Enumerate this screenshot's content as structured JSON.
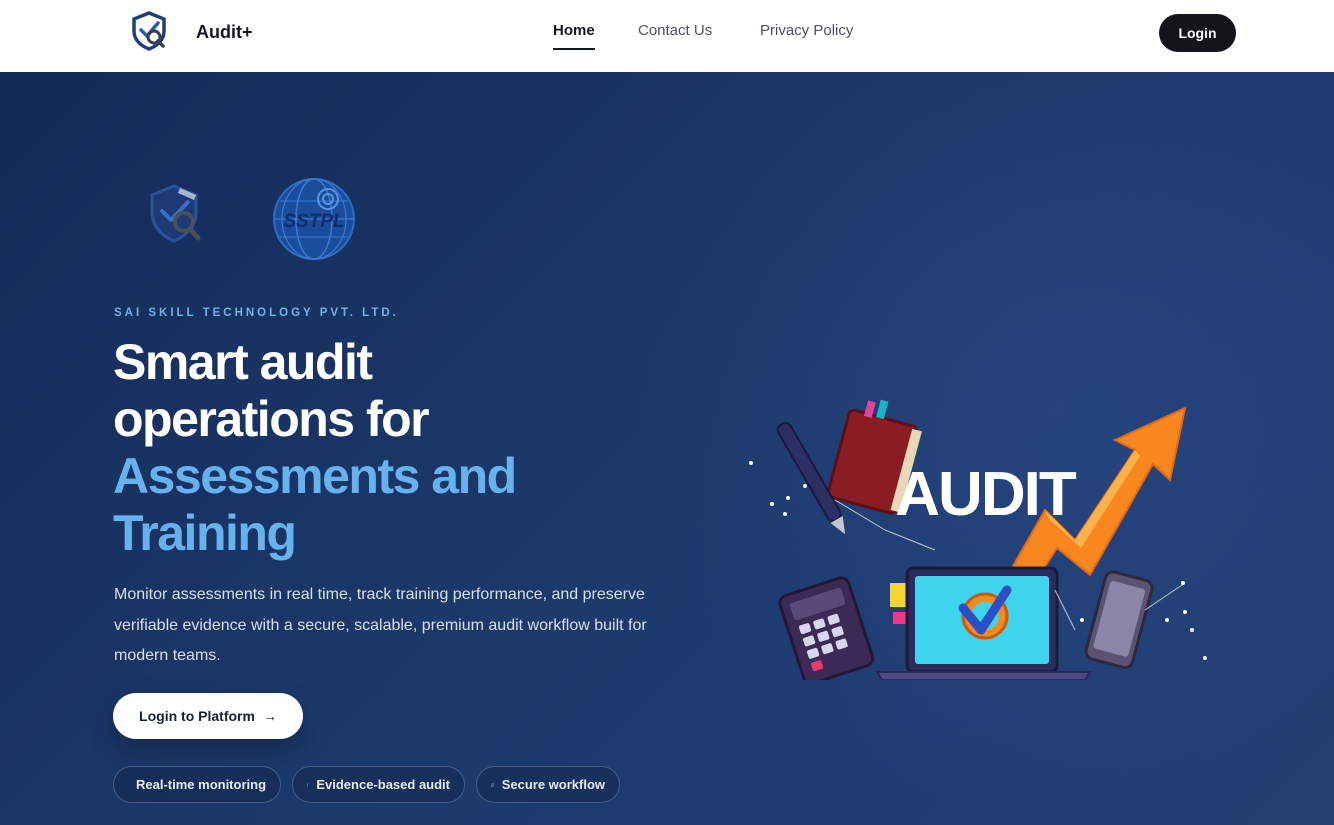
{
  "header": {
    "brand_name": "Audit+",
    "nav": [
      {
        "label": "Home",
        "active": true
      },
      {
        "label": "Contact Us",
        "active": false
      },
      {
        "label": "Privacy Policy",
        "active": false
      }
    ],
    "login_label": "Login"
  },
  "hero": {
    "kicker": "SAI SKILL TECHNOLOGY PVT. LTD.",
    "headline_line1": "Smart audit",
    "headline_line2": "operations for",
    "headline_accent1": "Assessments and",
    "headline_accent2": "Training",
    "description": "Monitor assessments in real time, track training performance, and preserve verifiable evidence with a secure, scalable, premium audit workflow built for modern teams.",
    "cta_label": "Login to Platform",
    "cta_icon": "arrow-right-icon",
    "chips": [
      "Real-time monitoring",
      "Evidence-based audit",
      "Secure workflow"
    ],
    "logo_b_text": "SSTPL",
    "illustration_text": "AUDIT"
  },
  "colors": {
    "hero_bg": "#1b3566",
    "accent": "#65b2ee",
    "kicker": "#6ab4f0",
    "header_bg": "#ffffff",
    "dark_button": "#14151b"
  }
}
